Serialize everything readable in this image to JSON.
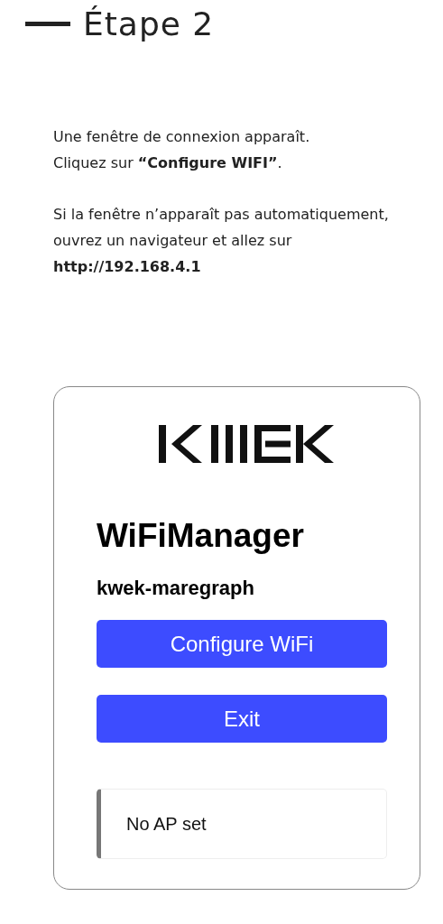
{
  "step_title": "Étape 2",
  "paragraphs": [
    [
      "Une fenêtre de connexion apparaît.",
      "Cliquez sur **“Configure WIFI”**."
    ],
    [
      "Si la fenêtre n’apparaît pas automatiquement,",
      "ouvrez un navigateur et allez sur",
      "**http://192.168.4.1**"
    ]
  ],
  "portal": {
    "title": "WiFiManager",
    "device_name": "kwek-maregraph",
    "buttons": [
      {
        "label": "Configure WiFi"
      },
      {
        "label": "Exit"
      }
    ],
    "status": "No AP set"
  }
}
